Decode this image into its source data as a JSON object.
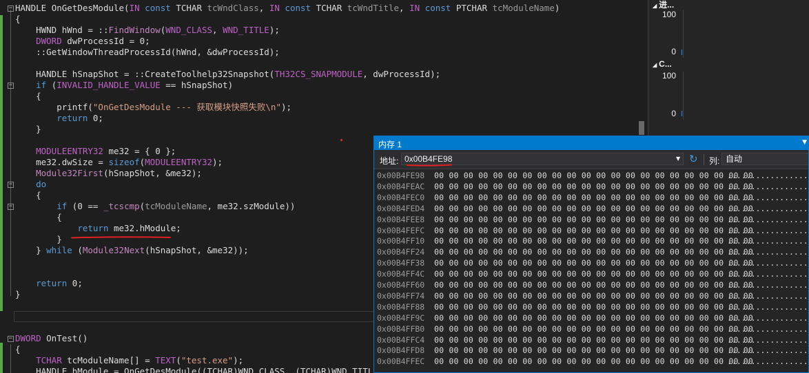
{
  "editor": {
    "lines": [
      [
        {
          "t": "HANDLE ",
          "c": "plain"
        },
        {
          "t": "OnGetDesModule",
          "c": "plain"
        },
        {
          "t": "(",
          "c": "plain"
        },
        {
          "t": "IN",
          "c": "mac"
        },
        {
          "t": " ",
          "c": "plain"
        },
        {
          "t": "const",
          "c": "kw"
        },
        {
          "t": " TCHAR ",
          "c": "plain"
        },
        {
          "t": "tcWndClass",
          "c": "pm"
        },
        {
          "t": ", ",
          "c": "plain"
        },
        {
          "t": "IN",
          "c": "mac"
        },
        {
          "t": " ",
          "c": "plain"
        },
        {
          "t": "const",
          "c": "kw"
        },
        {
          "t": " TCHAR ",
          "c": "plain"
        },
        {
          "t": "tcWndTitle",
          "c": "pm"
        },
        {
          "t": ", ",
          "c": "plain"
        },
        {
          "t": "IN",
          "c": "mac"
        },
        {
          "t": " ",
          "c": "plain"
        },
        {
          "t": "const",
          "c": "kw"
        },
        {
          "t": " PTCHAR ",
          "c": "plain"
        },
        {
          "t": "tcModuleName",
          "c": "pm"
        },
        {
          "t": ")",
          "c": "plain"
        }
      ],
      [
        {
          "t": "{",
          "c": "plain"
        }
      ],
      [
        {
          "t": "    HWND ",
          "c": "plain"
        },
        {
          "t": "hWnd = ",
          "c": "plain"
        },
        {
          "t": "::",
          "c": "plain"
        },
        {
          "t": "FindWindow",
          "c": "fnp"
        },
        {
          "t": "(",
          "c": "plain"
        },
        {
          "t": "WND_CLASS",
          "c": "mac"
        },
        {
          "t": ", ",
          "c": "plain"
        },
        {
          "t": "WND_TITLE",
          "c": "mac"
        },
        {
          "t": ");",
          "c": "plain"
        }
      ],
      [
        {
          "t": "    DWORD ",
          "c": "mac"
        },
        {
          "t": "dwProcessId = 0;",
          "c": "plain"
        }
      ],
      [
        {
          "t": "    ::",
          "c": "plain"
        },
        {
          "t": "GetWindowThreadProcessId",
          "c": "plain"
        },
        {
          "t": "(hWnd, &dwProcessId);",
          "c": "plain"
        }
      ],
      [
        {
          "t": "",
          "c": "plain"
        }
      ],
      [
        {
          "t": "    HANDLE ",
          "c": "plain"
        },
        {
          "t": "hSnapShot = ::",
          "c": "plain"
        },
        {
          "t": "CreateToolhelp32Snapshot",
          "c": "plain"
        },
        {
          "t": "(",
          "c": "plain"
        },
        {
          "t": "TH32CS_SNAPMODULE",
          "c": "mac"
        },
        {
          "t": ", dwProcessId);",
          "c": "plain"
        }
      ],
      [
        {
          "t": "    ",
          "c": "plain"
        },
        {
          "t": "if",
          "c": "kw"
        },
        {
          "t": " (",
          "c": "plain"
        },
        {
          "t": "INVALID_HANDLE_VALUE",
          "c": "mac"
        },
        {
          "t": " == hSnapShot)",
          "c": "plain"
        }
      ],
      [
        {
          "t": "    {",
          "c": "plain"
        }
      ],
      [
        {
          "t": "        printf(",
          "c": "plain"
        },
        {
          "t": "\"OnGetDesModule --- 获取模块快照失败\\n\"",
          "c": "str"
        },
        {
          "t": ");",
          "c": "plain"
        }
      ],
      [
        {
          "t": "        ",
          "c": "plain"
        },
        {
          "t": "return",
          "c": "kw"
        },
        {
          "t": " 0;",
          "c": "plain"
        }
      ],
      [
        {
          "t": "    }",
          "c": "plain"
        }
      ],
      [
        {
          "t": "",
          "c": "plain"
        }
      ],
      [
        {
          "t": "    ",
          "c": "plain"
        },
        {
          "t": "MODULEENTRY32",
          "c": "mac"
        },
        {
          "t": " me32 = { 0 };",
          "c": "plain"
        }
      ],
      [
        {
          "t": "    me32.dwSize = ",
          "c": "plain"
        },
        {
          "t": "sizeof",
          "c": "kw"
        },
        {
          "t": "(",
          "c": "plain"
        },
        {
          "t": "MODULEENTRY32",
          "c": "mac"
        },
        {
          "t": ");",
          "c": "plain"
        }
      ],
      [
        {
          "t": "    ",
          "c": "plain"
        },
        {
          "t": "Module32First",
          "c": "fnp"
        },
        {
          "t": "(hSnapShot, &me32);",
          "c": "plain"
        }
      ],
      [
        {
          "t": "    ",
          "c": "plain"
        },
        {
          "t": "do",
          "c": "kw"
        }
      ],
      [
        {
          "t": "    {",
          "c": "plain"
        }
      ],
      [
        {
          "t": "        ",
          "c": "plain"
        },
        {
          "t": "if",
          "c": "kw"
        },
        {
          "t": " (0 == ",
          "c": "plain"
        },
        {
          "t": "_tcscmp",
          "c": "fnp"
        },
        {
          "t": "(",
          "c": "plain"
        },
        {
          "t": "tcModuleName",
          "c": "pm"
        },
        {
          "t": ", me32.szModule))",
          "c": "plain"
        }
      ],
      [
        {
          "t": "        {",
          "c": "plain"
        }
      ],
      [
        {
          "t": "            ",
          "c": "plain"
        },
        {
          "t": "return",
          "c": "kw"
        },
        {
          "t": " me32.hModule;",
          "c": "plain"
        }
      ],
      [
        {
          "t": "        }",
          "c": "plain"
        }
      ],
      [
        {
          "t": "    } ",
          "c": "plain"
        },
        {
          "t": "while",
          "c": "kw"
        },
        {
          "t": " (",
          "c": "plain"
        },
        {
          "t": "Module32Next",
          "c": "fnp"
        },
        {
          "t": "(hSnapShot, &me32));",
          "c": "plain"
        }
      ],
      [
        {
          "t": "",
          "c": "plain"
        }
      ],
      [
        {
          "t": "",
          "c": "plain"
        }
      ],
      [
        {
          "t": "    ",
          "c": "plain"
        },
        {
          "t": "return",
          "c": "kw"
        },
        {
          "t": " 0;",
          "c": "plain"
        }
      ],
      [
        {
          "t": "}",
          "c": "plain"
        }
      ],
      [
        {
          "t": "",
          "c": "plain"
        }
      ],
      [
        {
          "t": "",
          "c": "plain"
        }
      ],
      [
        {
          "t": "",
          "c": "plain"
        }
      ],
      [
        {
          "t": "DWORD ",
          "c": "mac"
        },
        {
          "t": "OnTest()",
          "c": "plain"
        }
      ],
      [
        {
          "t": "{",
          "c": "plain"
        }
      ],
      [
        {
          "t": "    TCHAR ",
          "c": "mac"
        },
        {
          "t": "tcModuleName[] = ",
          "c": "plain"
        },
        {
          "t": "TEXT",
          "c": "mac"
        },
        {
          "t": "(",
          "c": "plain"
        },
        {
          "t": "\"test.exe\"",
          "c": "str"
        },
        {
          "t": ");",
          "c": "plain"
        }
      ],
      [
        {
          "t": "    HANDLE hModule = OnGetDesModule((TCHAR)WND_CLASS, (TCHAR)WND_TITLE, tcModuleName);",
          "c": "plain"
        }
      ]
    ]
  },
  "diagnostics": {
    "section1_label": "进...",
    "section1_max": "100",
    "section1_min": "0",
    "section2_label": "C...",
    "section2_max": "100",
    "section2_min": "0"
  },
  "memory_window": {
    "title": "内存 1",
    "address_label": "地址:",
    "address_value": "0x00B4FE98",
    "column_label": "列:",
    "column_value": "自动",
    "hex_bytes": "00 00 00 00 00 00 00 00 00 00 00 00 00 00 00 00 00 00 00 00 00 00",
    "ascii": "......................",
    "rows": [
      "0x00B4FE98",
      "0x00B4FEAC",
      "0x00B4FEC0",
      "0x00B4FED4",
      "0x00B4FEE8",
      "0x00B4FEFC",
      "0x00B4FF10",
      "0x00B4FF24",
      "0x00B4FF38",
      "0x00B4FF4C",
      "0x00B4FF60",
      "0x00B4FF74",
      "0x00B4FF88",
      "0x00B4FF9C",
      "0x00B4FFB0",
      "0x00B4FFC4",
      "0x00B4FFD8",
      "0x00B4FFEC"
    ]
  },
  "colors": {
    "editor_bg": "#1e1e1e",
    "accent": "#007acc",
    "annotation_red": "#e02020"
  }
}
